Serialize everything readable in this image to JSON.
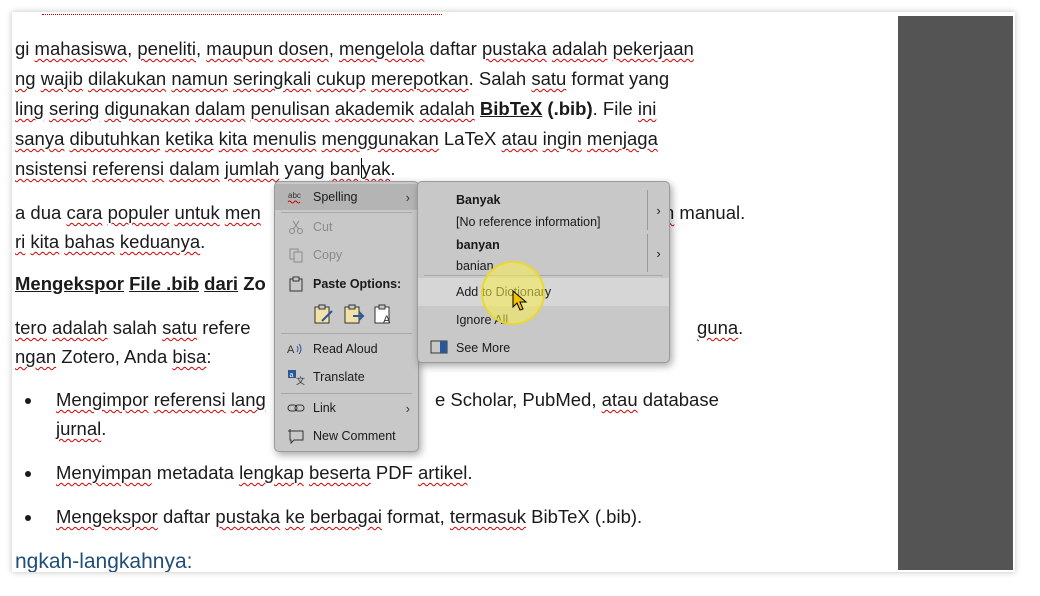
{
  "document": {
    "para1": {
      "line1": [
        "gi ",
        "mahasiswa",
        ", ",
        "peneliti",
        ", ",
        "maupun",
        " ",
        "dosen",
        ", ",
        "mengelola",
        " daftar ",
        "pustaka",
        " ",
        "adalah",
        " ",
        "pekerjaan"
      ],
      "line2": [
        "ng",
        " ",
        "wajib",
        " ",
        "dilakukan",
        " ",
        "namun",
        " ",
        "seringkali",
        " ",
        "cukup",
        " ",
        "merepotkan",
        ". Salah ",
        "satu",
        " format yang"
      ],
      "line3": [
        "ling",
        " ",
        "sering",
        " ",
        "digunakan",
        " ",
        "dalam",
        " ",
        "penulisan",
        " ",
        "akademik",
        " ",
        "adalah",
        " ",
        "BibTeX",
        " (.bib)",
        ". File ",
        "ini"
      ],
      "line4": [
        "sanya",
        " ",
        "dibutuhkan",
        " ",
        "ketika",
        " ",
        "kita",
        " ",
        "menulis",
        " ",
        "menggunakan",
        " LaTeX ",
        "atau",
        " ",
        "ingin",
        " ",
        "menjaga"
      ],
      "line5": [
        "nsistensi",
        " ",
        "referensi",
        " ",
        "dalam",
        " ",
        "jumlah",
        " yang ",
        "ban",
        "yak",
        "."
      ]
    },
    "para2": {
      "line1_start": [
        "a dua ",
        "cara",
        " ",
        "populer",
        " ",
        "untuk",
        " ",
        "men"
      ],
      "line1_end": [
        "n",
        " manual."
      ],
      "line2": [
        "ri",
        " ",
        "kita",
        " ",
        "bahas",
        " ",
        "keduanya",
        "."
      ]
    },
    "heading1": [
      "Mengekspor",
      " ",
      "File .bib",
      " ",
      "dari",
      " Zo"
    ],
    "para3": {
      "line1_start": [
        "tero",
        " ",
        "adalah",
        " salah ",
        "satu",
        " refere"
      ],
      "line1_end": [
        "guna",
        "."
      ],
      "line2": [
        "ngan",
        " Zotero, Anda ",
        "bisa",
        ":"
      ]
    },
    "bullets": [
      {
        "line1_start": [
          "Mengimpor",
          " ",
          "referensi",
          " ",
          "lang"
        ],
        "line1_end": [
          "e Scholar, PubMed, ",
          "atau",
          " database"
        ],
        "line2": [
          "jurnal",
          "."
        ]
      },
      {
        "line1": [
          "Menyimpan",
          " metadata ",
          "lengkap",
          " ",
          "beserta",
          " PDF ",
          "artikel",
          "."
        ]
      },
      {
        "line1": [
          "Mengekspor",
          " daftar ",
          "pustaka",
          " ",
          "ke",
          " ",
          "berbagai",
          " format, ",
          "termasuk",
          " BibTeX (.bib)."
        ]
      }
    ],
    "heading2": "ngkah-langkahnya:"
  },
  "context_menu": {
    "items": [
      {
        "label": "Spelling",
        "icon": "abc-spelling-icon",
        "has_submenu": true,
        "enabled": true
      },
      {
        "label": "Cut",
        "icon": "scissors-icon",
        "enabled": false
      },
      {
        "label": "Copy",
        "icon": "copy-icon",
        "enabled": false
      },
      {
        "label": "Paste Options:",
        "icon": "clipboard-icon",
        "enabled": true
      },
      {
        "label": "Read Aloud",
        "icon": "read-aloud-icon",
        "enabled": true
      },
      {
        "label": "Translate",
        "icon": "translate-icon",
        "enabled": true
      },
      {
        "label": "Link",
        "icon": "link-icon",
        "has_submenu": true,
        "enabled": true
      },
      {
        "label": "New Comment",
        "icon": "new-comment-icon",
        "enabled": true
      }
    ],
    "paste_options": [
      "paste-keep-formatting-icon",
      "paste-merge-formatting-icon",
      "paste-text-only-icon"
    ]
  },
  "spelling_submenu": {
    "suggestions": [
      {
        "word": "Banyak",
        "detail": "[No reference information]"
      },
      {
        "word": "banyan",
        "detail": "banian"
      }
    ],
    "actions": [
      {
        "label": "Add to Dictionary",
        "highlighted": true
      },
      {
        "label": "Ignore All"
      },
      {
        "label": "See More",
        "icon": "see-more-icon"
      }
    ]
  },
  "colors": {
    "right_pane": "#545454",
    "menu_bg": "#c8c8c8",
    "squiggle": "#d20000",
    "heading_blue": "#1f4e79",
    "cursor_highlight": "#faf050"
  }
}
